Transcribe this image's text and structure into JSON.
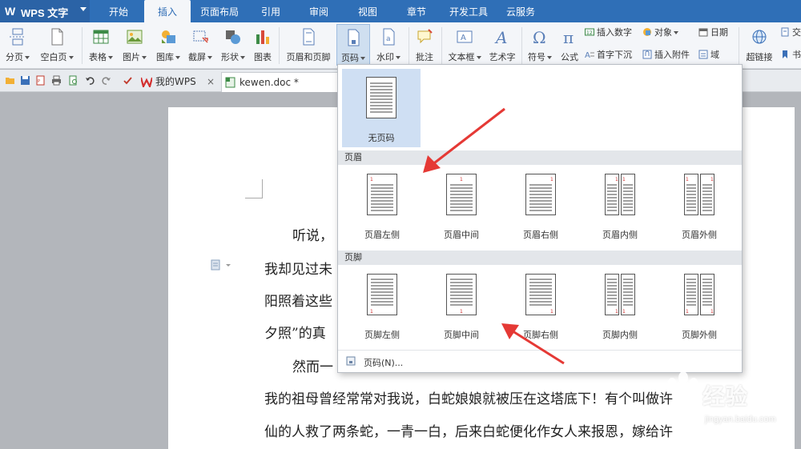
{
  "app": {
    "logo_letter": "W",
    "title": "WPS 文字"
  },
  "menu": [
    "开始",
    "插入",
    "页面布局",
    "引用",
    "审阅",
    "视图",
    "章节",
    "开发工具",
    "云服务"
  ],
  "menu_active": "插入",
  "ribbon": {
    "buttons": [
      "分页",
      "空白页",
      "表格",
      "图片",
      "图库",
      "截屏",
      "形状",
      "图表",
      "页眉和页脚",
      "页码",
      "水印",
      "批注",
      "文本框",
      "艺术字",
      "符号",
      "公式",
      "超链接"
    ],
    "small": {
      "insert_number": "插入数字",
      "object": "对象",
      "date": "日期",
      "first_drop": "首字下沉",
      "insert_attachment": "插入附件",
      "field": "域",
      "cut1": "交",
      "cut2": "书"
    }
  },
  "doc_tabs": [
    {
      "label": "我的WPS",
      "close": "×"
    },
    {
      "label": "kewen.doc *",
      "close": ""
    }
  ],
  "dropdown": {
    "none": "无页码",
    "header_section": "页眉",
    "header_options": [
      "页眉左侧",
      "页眉中间",
      "页眉右侧",
      "页眉内侧",
      "页眉外侧"
    ],
    "footer_section": "页脚",
    "footer_options": [
      "页脚左侧",
      "页脚中间",
      "页脚右侧",
      "页脚内侧",
      "页脚外侧"
    ],
    "page_number_item": "页码(N)...",
    "page_number_digit": "1"
  },
  "document_lines": [
    "听说，",
    "我却见过未",
    "阳照着这些",
    "夕照”的真",
    "然而一",
    "我的祖母曾经常常对我说，白蛇娘娘就被压在这塔底下！有个叫做许",
    "仙的人救了两条蛇，一青一白，后来白蛇便化作女人来报恩，嫁给许"
  ],
  "watermark": {
    "big": "经验",
    "small": "jingyan.baidu.com"
  },
  "colors": {
    "menubar": "#2f6fb7",
    "accent": "#2d6cb5",
    "arrow": "#e53935",
    "page_num": "#d32f2f"
  }
}
